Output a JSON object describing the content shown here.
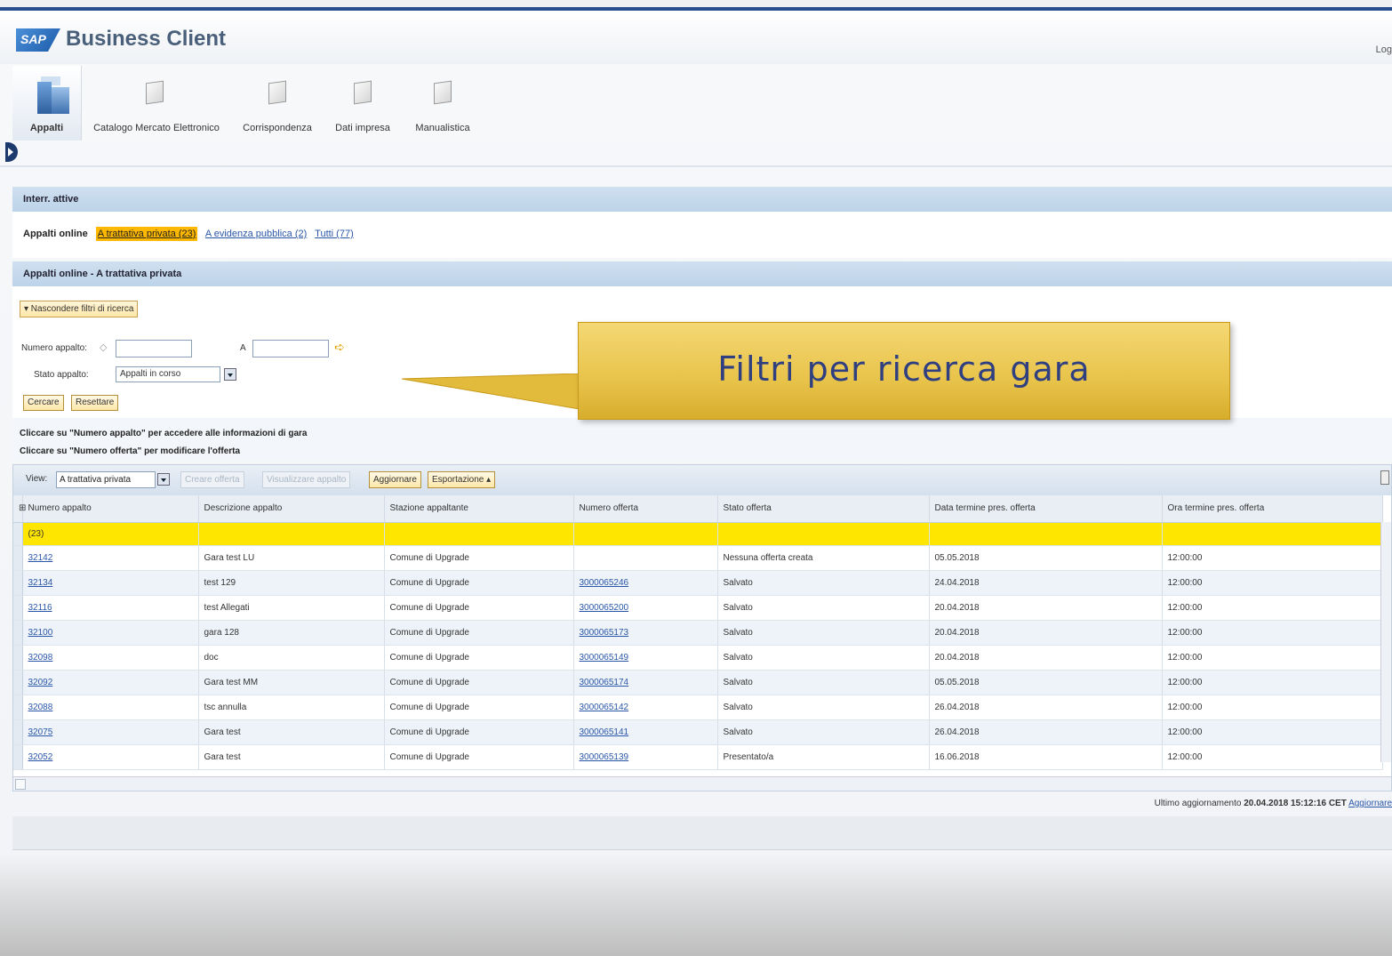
{
  "app": {
    "logo_text": "SAP",
    "title": "Business Client",
    "logoff": "Log"
  },
  "nav": {
    "items": [
      {
        "label": "Appalti",
        "active": true,
        "icon": "building-icon"
      },
      {
        "label": "Catalogo Mercato Elettronico",
        "icon": "document-icon"
      },
      {
        "label": "Corrispondenza",
        "icon": "document-icon"
      },
      {
        "label": "Dati impresa",
        "icon": "document-icon"
      },
      {
        "label": "Manualistica",
        "icon": "document-icon"
      }
    ]
  },
  "active_bar": {
    "title": "Interr. attive"
  },
  "tabs": {
    "label": "Appalti online",
    "selected": "A trattativa privata (23)",
    "links": [
      "A evidenza pubblica (2)",
      "Tutti (77)"
    ]
  },
  "section": {
    "title": "Appalti online - A trattativa privata"
  },
  "filters": {
    "toggle_label": "▾ Nascondere filtri di ricerca",
    "numero_label": "Numero appalto:",
    "numero_from": "",
    "to_label": "A",
    "numero_to": "",
    "stato_label": "Stato appalto:",
    "stato_value": "Appalti in corso",
    "search_button": "Cercare",
    "reset_button": "Resettare"
  },
  "instructions": {
    "line1": "Cliccare su \"Numero appalto\" per accedere alle informazioni di gara",
    "line2": "Cliccare su \"Numero offerta\" per modificare l'offerta"
  },
  "toolbar": {
    "view_label": "View:",
    "view_value": "A trattativa privata",
    "create_offer": "Creare offerta",
    "view_tender": "Visualizzare appalto",
    "refresh": "Aggiornare",
    "export": "Esportazione ▴"
  },
  "table": {
    "columns": [
      "Numero appalto",
      "Descrizione appalto",
      "Stazione appaltante",
      "Numero offerta",
      "Stato offerta",
      "Data termine pres. offerta",
      "Ora termine pres. offerta"
    ],
    "filter_row": "(23)",
    "rows": [
      {
        "numero": "32142",
        "descrizione": "Gara test LU",
        "stazione": "Comune di Upgrade",
        "offerta": "",
        "stato": "Nessuna offerta creata",
        "data": "05.05.2018",
        "ora": "12:00:00"
      },
      {
        "numero": "32134",
        "descrizione": "test 129",
        "stazione": "Comune di Upgrade",
        "offerta": "3000065246",
        "stato": "Salvato",
        "data": "24.04.2018",
        "ora": "12:00:00"
      },
      {
        "numero": "32116",
        "descrizione": "test Allegati",
        "stazione": "Comune di Upgrade",
        "offerta": "3000065200",
        "stato": "Salvato",
        "data": "20.04.2018",
        "ora": "12:00:00"
      },
      {
        "numero": "32100",
        "descrizione": "gara 128",
        "stazione": "Comune di Upgrade",
        "offerta": "3000065173",
        "stato": "Salvato",
        "data": "20.04.2018",
        "ora": "12:00:00"
      },
      {
        "numero": "32098",
        "descrizione": "doc",
        "stazione": "Comune di Upgrade",
        "offerta": "3000065149",
        "stato": "Salvato",
        "data": "20.04.2018",
        "ora": "12:00:00"
      },
      {
        "numero": "32092",
        "descrizione": "Gara test MM",
        "stazione": "Comune di Upgrade",
        "offerta": "3000065174",
        "stato": "Salvato",
        "data": "05.05.2018",
        "ora": "12:00:00"
      },
      {
        "numero": "32088",
        "descrizione": "tsc annulla",
        "stazione": "Comune di Upgrade",
        "offerta": "3000065142",
        "stato": "Salvato",
        "data": "26.04.2018",
        "ora": "12:00:00"
      },
      {
        "numero": "32075",
        "descrizione": "Gara test",
        "stazione": "Comune di Upgrade",
        "offerta": "3000065141",
        "stato": "Salvato",
        "data": "26.04.2018",
        "ora": "12:00:00"
      },
      {
        "numero": "32052",
        "descrizione": "Gara test",
        "stazione": "Comune di Upgrade",
        "offerta": "3000065139",
        "stato": "Presentato/a",
        "data": "16.06.2018",
        "ora": "12:00:00"
      }
    ]
  },
  "status": {
    "prefix": "Ultimo aggiornamento",
    "timestamp": "20.04.2018 15:12:16 CET",
    "link": "Aggiornare"
  },
  "callout": {
    "text": "Filtri per ricerca gara"
  }
}
